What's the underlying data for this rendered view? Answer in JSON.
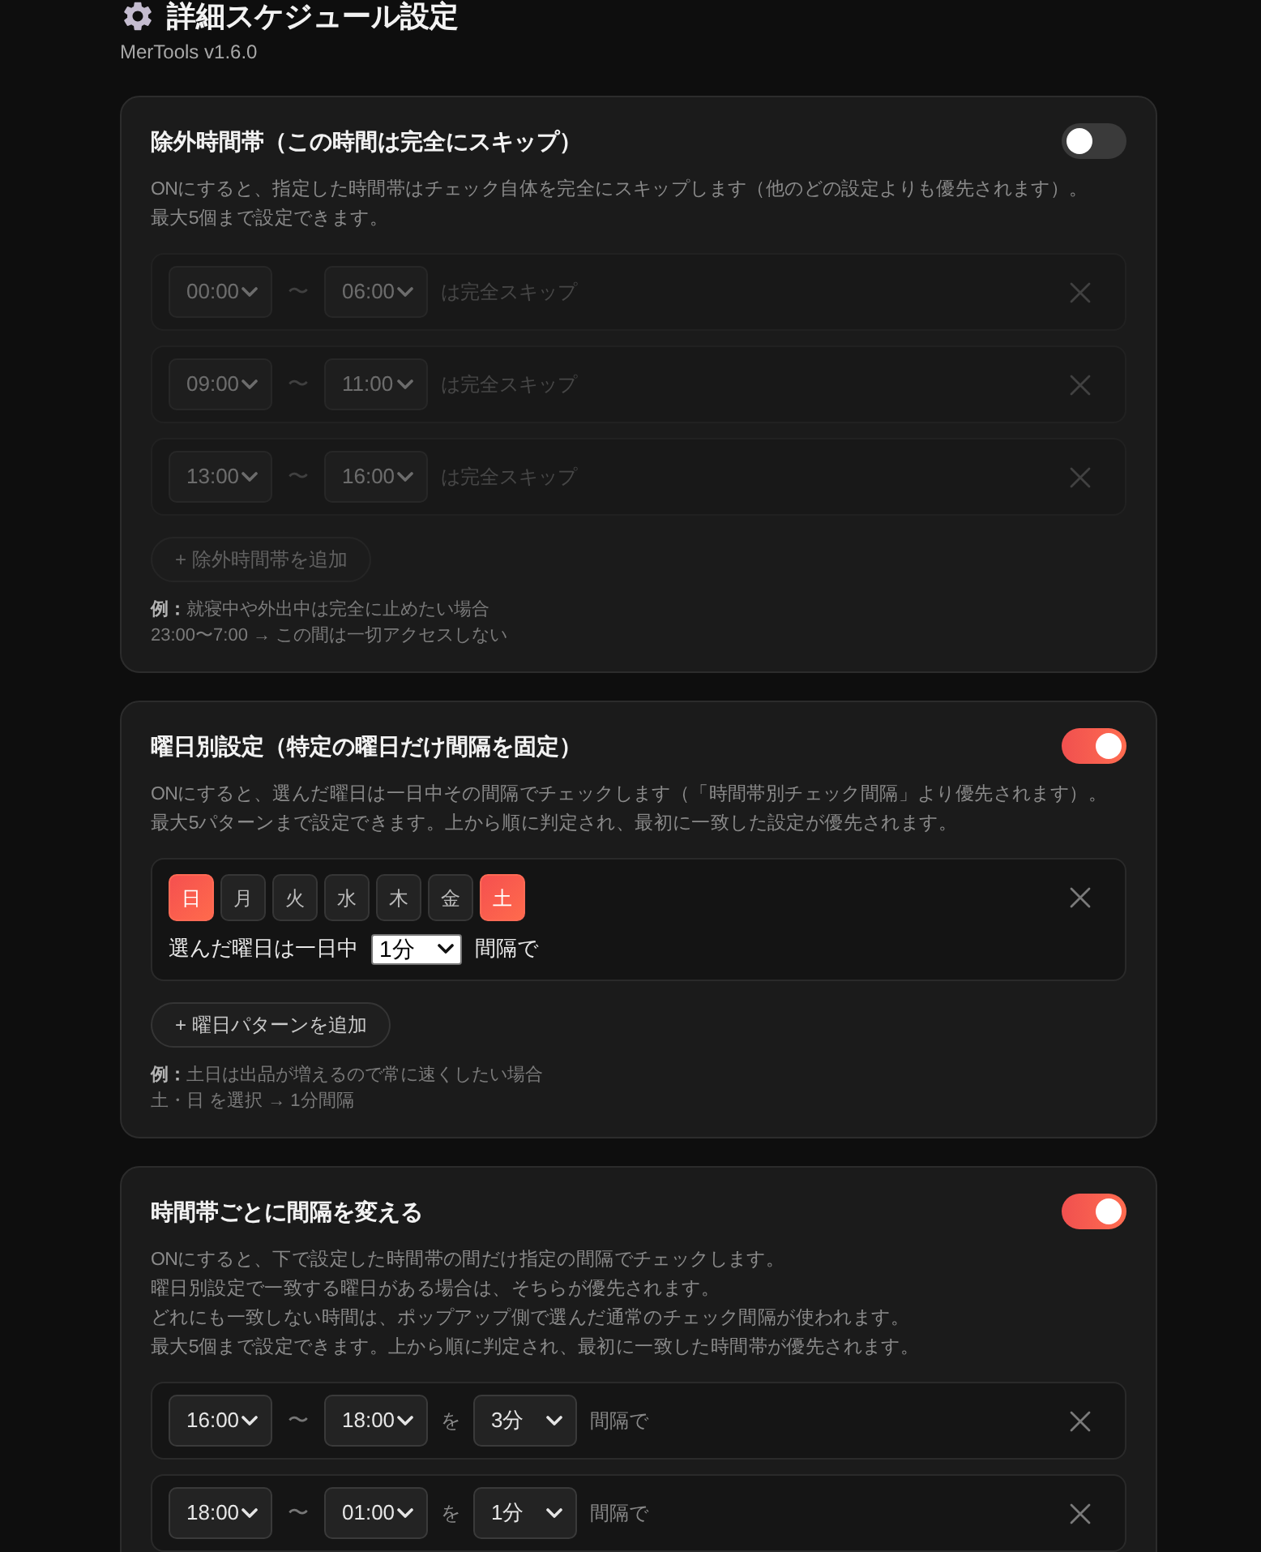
{
  "header": {
    "title": "詳細スケジュール設定",
    "version": "MerTools v1.6.0"
  },
  "sections": [
    {
      "kind": "time_ranges",
      "title": "除外時間帯（この時間は完全にスキップ）",
      "on": false,
      "description": [
        "ONにすると、指定した時間帯はチェック自体を完全にスキップします（他のどの設定よりも優先されます）。",
        "最大5個まで設定できます。"
      ],
      "rows": [
        {
          "from": "00:00",
          "separator": "〜",
          "to": "06:00",
          "suffix": "は完全スキップ"
        },
        {
          "from": "09:00",
          "separator": "〜",
          "to": "11:00",
          "suffix": "は完全スキップ"
        },
        {
          "from": "13:00",
          "separator": "〜",
          "to": "16:00",
          "suffix": "は完全スキップ"
        }
      ],
      "add_button": "+ 除外時間帯を追加",
      "example": [
        "**例：**就寝中や外出中は完全に止めたい場合",
        "23:00〜7:00 → この間は一切アクセスしない"
      ]
    },
    {
      "kind": "weekdays",
      "title": "曜日別設定（特定の曜日だけ間隔を固定）",
      "on": true,
      "description": [
        "ONにすると、選んだ曜日は一日中その間隔でチェックします（「時間帯別チェック間隔」より優先されます）。",
        "最大5パターンまで設定できます。上から順に判定され、最初に一致した設定が優先されます。"
      ],
      "patterns": [
        {
          "days": [
            {
              "label": "日",
              "selected": true
            },
            {
              "label": "月",
              "selected": false
            },
            {
              "label": "火",
              "selected": false
            },
            {
              "label": "水",
              "selected": false
            },
            {
              "label": "木",
              "selected": false
            },
            {
              "label": "金",
              "selected": false
            },
            {
              "label": "土",
              "selected": true
            }
          ],
          "prefix": "選んだ曜日は一日中",
          "interval": "1分",
          "suffix": "間隔で"
        }
      ],
      "add_button": "+ 曜日パターンを追加",
      "example": [
        "**例：**土日は出品が増えるので常に速くしたい場合",
        "土・日 を選択 → 1分間隔"
      ]
    },
    {
      "kind": "interval_ranges",
      "title": "時間帯ごとに間隔を変える",
      "on": true,
      "description": [
        "ONにすると、下で設定した時間帯の間だけ指定の間隔でチェックします。",
        "曜日別設定で一致する曜日がある場合は、そちらが優先されます。",
        "どれにも一致しない時間は、ポップアップ側で選んだ通常のチェック間隔が使われます。",
        "最大5個まで設定できます。上から順に判定され、最初に一致した時間帯が優先されます。"
      ],
      "rows": [
        {
          "from": "16:00",
          "separator": "〜",
          "to": "18:00",
          "connector": "を",
          "interval": "3分",
          "suffix": "間隔で"
        },
        {
          "from": "18:00",
          "separator": "〜",
          "to": "01:00",
          "connector": "を",
          "interval": "1分",
          "suffix": "間隔で"
        }
      ]
    }
  ]
}
